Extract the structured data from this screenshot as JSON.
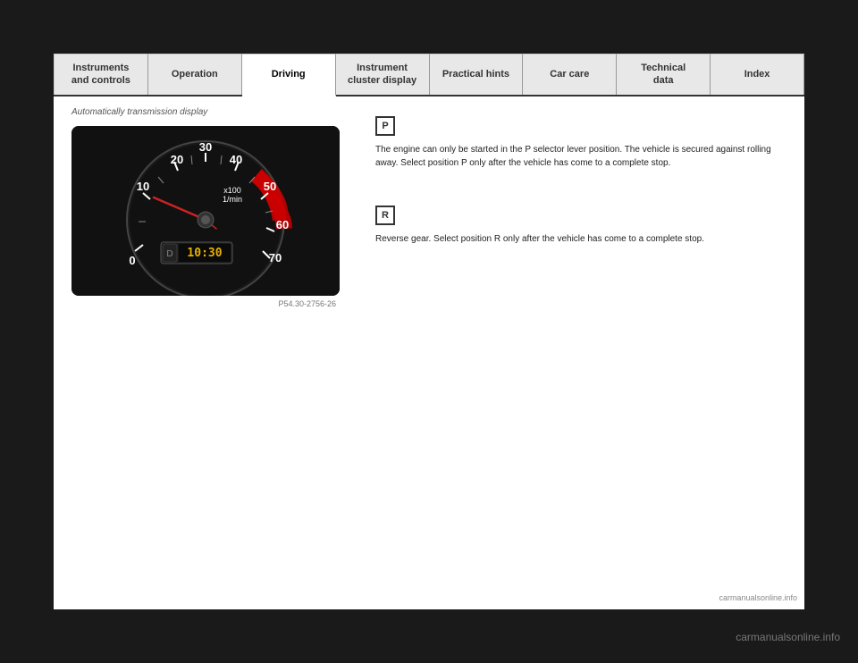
{
  "nav": {
    "tabs": [
      {
        "label": "Instruments\nand controls",
        "active": false,
        "id": "instruments"
      },
      {
        "label": "Operation",
        "active": false,
        "id": "operation"
      },
      {
        "label": "Driving",
        "active": true,
        "id": "driving"
      },
      {
        "label": "Instrument\ncluster display",
        "active": false,
        "id": "instrument-cluster"
      },
      {
        "label": "Practical hints",
        "active": false,
        "id": "practical-hints"
      },
      {
        "label": "Car care",
        "active": false,
        "id": "car-care"
      },
      {
        "label": "Technical\ndata",
        "active": false,
        "id": "technical-data"
      },
      {
        "label": "Index",
        "active": false,
        "id": "index"
      }
    ]
  },
  "page": {
    "subtitle": "Automatically transmission display",
    "image_caption": "P54.30-2756-26",
    "p_badge": "P",
    "r_badge": "R",
    "p_text": "The engine can only be started in the P selector lever position. The vehicle is secured against rolling away. Select position P only after the vehicle has come to a complete stop.",
    "r_text": "Reverse gear. Select position R only after the vehicle has come to a complete stop."
  },
  "watermark": "carmanualsonline.info",
  "tachometer": {
    "labels": [
      "0",
      "10",
      "20",
      "30",
      "40",
      "50",
      "60",
      "70"
    ],
    "unit": "x100\n1/min",
    "time_display": "10:30"
  }
}
